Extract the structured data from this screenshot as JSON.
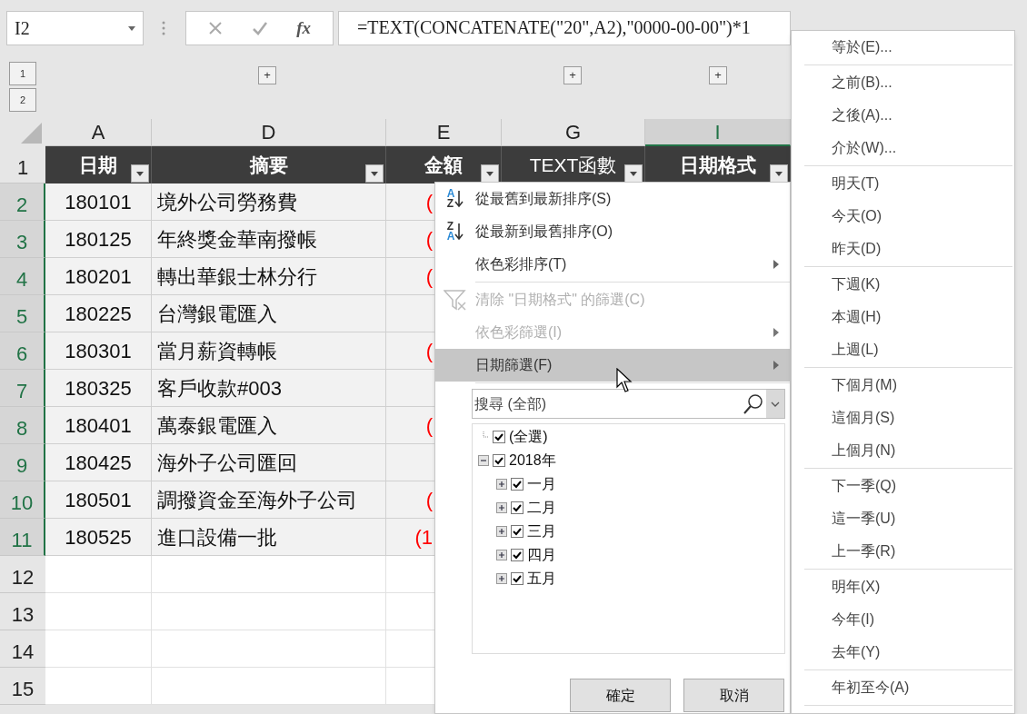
{
  "name_box": "I2",
  "function_button": "fx",
  "formula": "=TEXT(CONCATENATE(\"20\",A2),\"0000-00-00\")*1",
  "outline": {
    "levels": [
      "1",
      "2"
    ],
    "expand_buttons": [
      "+",
      "+",
      "+"
    ]
  },
  "columns": [
    {
      "label": "A",
      "selected": false
    },
    {
      "label": "D",
      "selected": false
    },
    {
      "label": "E",
      "selected": false
    },
    {
      "label": "G",
      "selected": false
    },
    {
      "label": "I",
      "selected": true
    }
  ],
  "header_row": {
    "number": "1",
    "cells": [
      "日期",
      "摘要",
      "金額",
      "TEXT函數",
      "日期格式"
    ]
  },
  "rows": [
    {
      "number": "2",
      "filtered": true,
      "date": "180101",
      "summary": "境外公司勞務費",
      "amount": "("
    },
    {
      "number": "3",
      "filtered": true,
      "date": "180125",
      "summary": "年終獎金華南撥帳",
      "amount": "("
    },
    {
      "number": "4",
      "filtered": true,
      "date": "180201",
      "summary": "轉出華銀士林分行",
      "amount": "("
    },
    {
      "number": "5",
      "filtered": true,
      "date": "180225",
      "summary": "台灣銀電匯入"
    },
    {
      "number": "6",
      "filtered": true,
      "date": "180301",
      "summary": "當月薪資轉帳",
      "amount": "("
    },
    {
      "number": "7",
      "filtered": true,
      "date": "180325",
      "summary": "客戶收款#003"
    },
    {
      "number": "8",
      "filtered": true,
      "date": "180401",
      "summary": "萬泰銀電匯入",
      "amount": "("
    },
    {
      "number": "9",
      "filtered": true,
      "date": "180425",
      "summary": "海外子公司匯回"
    },
    {
      "number": "10",
      "filtered": true,
      "date": "180501",
      "summary": "調撥資金至海外子公司",
      "amount": "("
    },
    {
      "number": "11",
      "filtered": true,
      "date": "180525",
      "summary": "進口設備一批",
      "amount": "(1"
    },
    {
      "number": "12",
      "filtered": false
    },
    {
      "number": "13",
      "filtered": false
    },
    {
      "number": "14",
      "filtered": false
    },
    {
      "number": "15",
      "filtered": false
    }
  ],
  "filter_menu": {
    "items": [
      {
        "kind": "sort_ascending",
        "icon_letters": [
          "A",
          "Z"
        ],
        "label": "從最舊到最新排序(S)",
        "disabled": false,
        "submenu": false,
        "highlighted": false
      },
      {
        "kind": "sort_descending",
        "icon_letters": [
          "Z",
          "A"
        ],
        "label": "從最新到最舊排序(O)",
        "disabled": false,
        "submenu": false,
        "highlighted": false
      },
      {
        "kind": "plain",
        "label": "依色彩排序(T)",
        "disabled": false,
        "submenu": true,
        "highlighted": false
      },
      {
        "kind": "separator"
      },
      {
        "kind": "clear_filter",
        "label": "清除 \"日期格式\" 的篩選(C)",
        "disabled": true,
        "submenu": false,
        "highlighted": false
      },
      {
        "kind": "plain",
        "label": "依色彩篩選(I)",
        "disabled": true,
        "submenu": true,
        "highlighted": false
      },
      {
        "kind": "plain",
        "label": "日期篩選(F)",
        "disabled": false,
        "submenu": true,
        "highlighted": true
      },
      {
        "kind": "separator"
      }
    ],
    "search": {
      "placeholder": "搜尋 (全部)"
    },
    "tree": [
      {
        "label": "(全選)",
        "checked": true
      },
      {
        "label": "2018年",
        "checked": true,
        "expanded": true,
        "children": [
          {
            "label": "一月",
            "checked": true,
            "expanded": false
          },
          {
            "label": "二月",
            "checked": true,
            "expanded": false
          },
          {
            "label": "三月",
            "checked": true,
            "expanded": false
          },
          {
            "label": "四月",
            "checked": true,
            "expanded": false
          },
          {
            "label": "五月",
            "checked": true,
            "expanded": false
          }
        ]
      }
    ],
    "buttons": [
      "確定",
      "取消"
    ]
  },
  "date_filter_submenu": {
    "groups": [
      [
        "等於(E)..."
      ],
      [
        "之前(B)...",
        "之後(A)...",
        "介於(W)..."
      ],
      [
        "明天(T)",
        "今天(O)",
        "昨天(D)"
      ],
      [
        "下週(K)",
        "本週(H)",
        "上週(L)"
      ],
      [
        "下個月(M)",
        "這個月(S)",
        "上個月(N)"
      ],
      [
        "下一季(Q)",
        "這一季(U)",
        "上一季(R)"
      ],
      [
        "明年(X)",
        "今年(I)",
        "去年(Y)"
      ],
      [
        "年初至今(A)"
      ]
    ]
  }
}
